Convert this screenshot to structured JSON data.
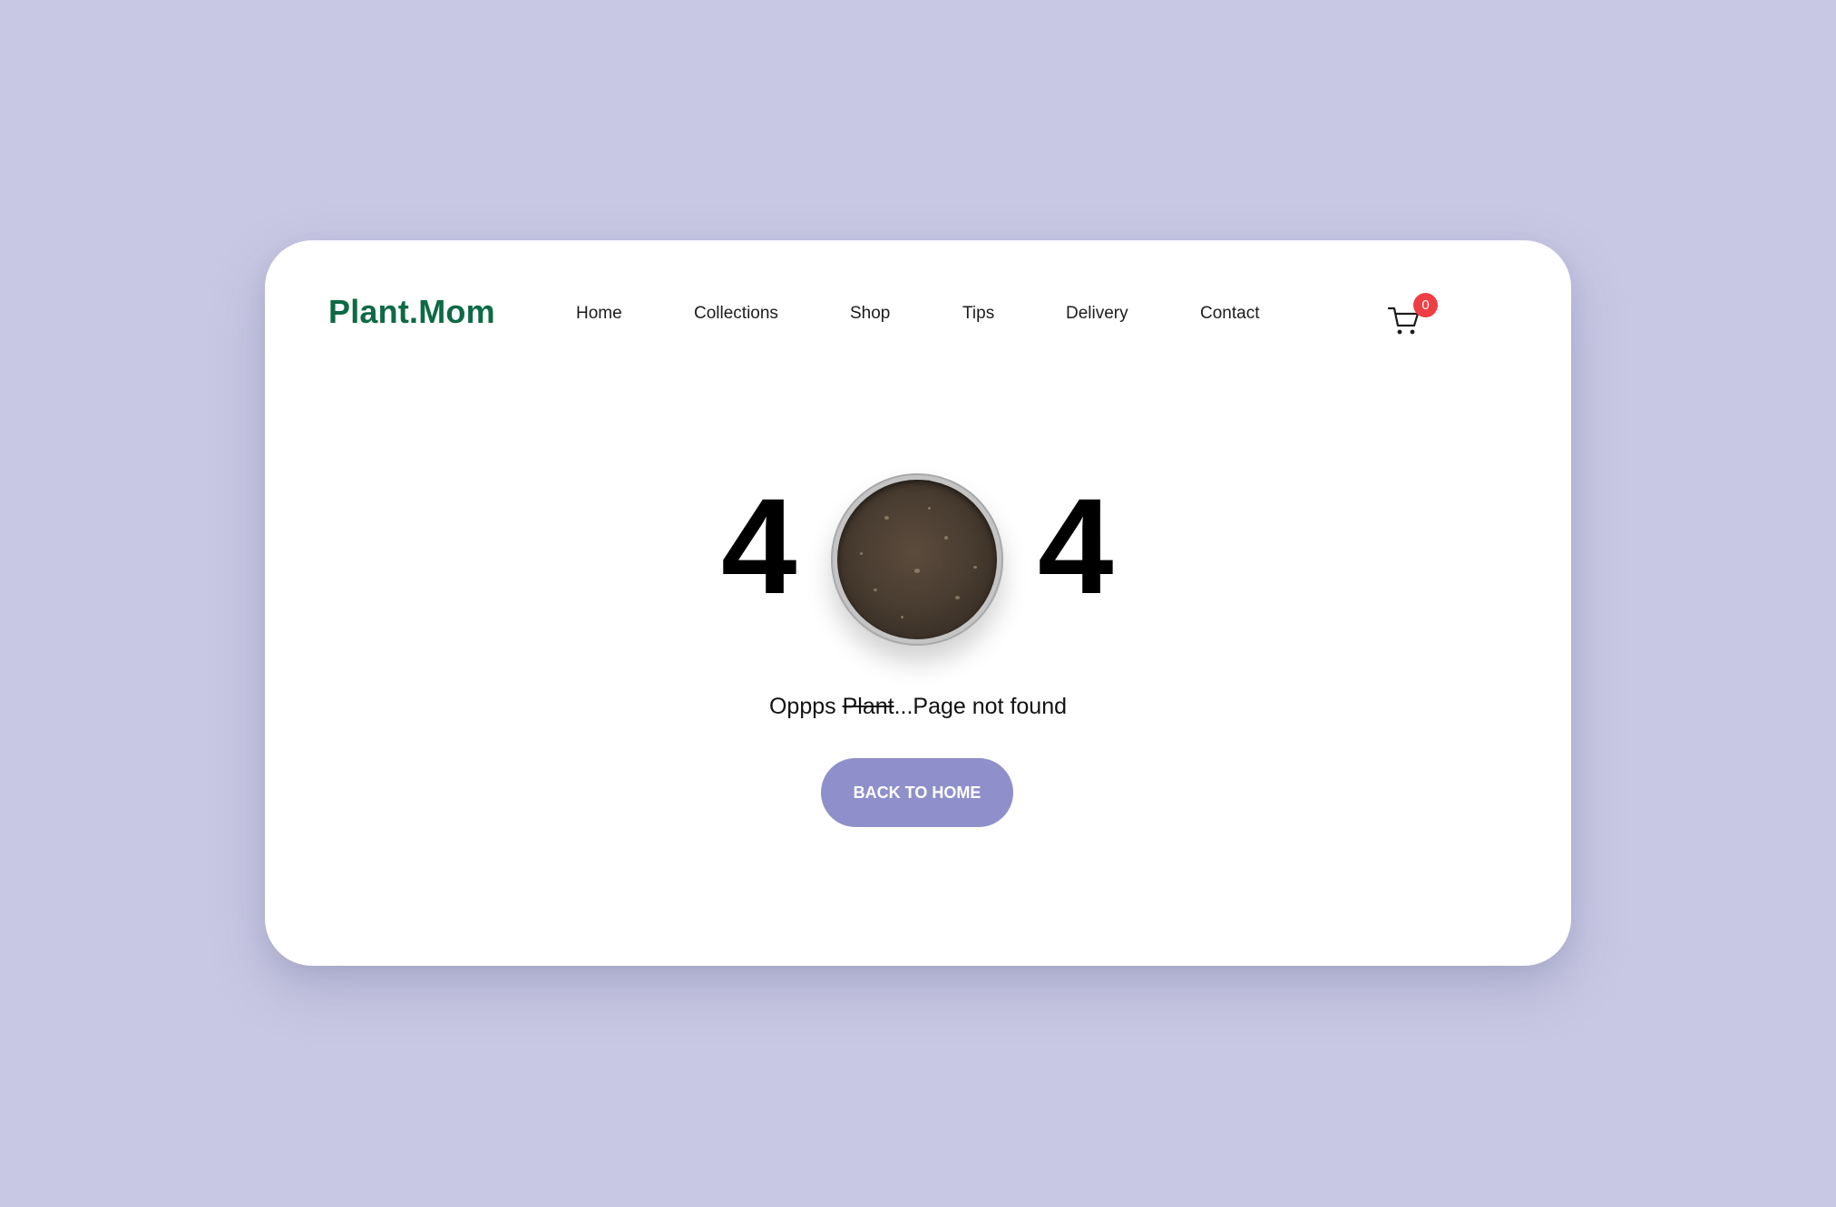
{
  "brand": {
    "logo": "Plant.Mom",
    "color": "#0d6a45"
  },
  "nav": {
    "items": [
      {
        "label": "Home"
      },
      {
        "label": "Collections"
      },
      {
        "label": "Shop"
      },
      {
        "label": "Tips"
      },
      {
        "label": "Delivery"
      },
      {
        "label": "Contact"
      }
    ]
  },
  "cart": {
    "icon": "cart-icon",
    "count": "0",
    "badge_color": "#ef3e43"
  },
  "error": {
    "digit_left": "4",
    "digit_right": "4",
    "center_image": "soil-pot",
    "message_prefix": "Oppps ",
    "message_struck": "Plant",
    "message_suffix": "...Page not found"
  },
  "cta": {
    "label": "BACK TO HOME",
    "color": "#8f8fcb"
  },
  "colors": {
    "background": "#c8c8e4",
    "card": "#ffffff"
  }
}
